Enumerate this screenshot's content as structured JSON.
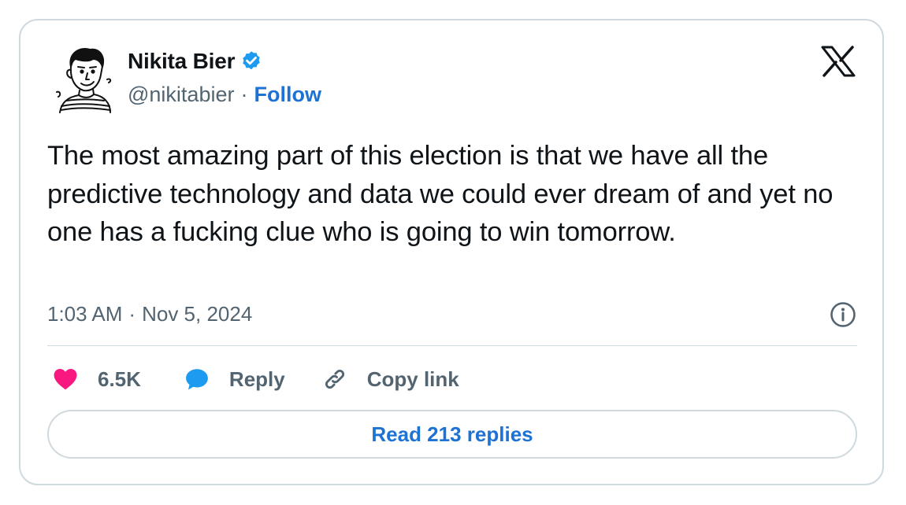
{
  "author": {
    "name": "Nikita Bier",
    "handle": "@nikitabier",
    "separator": "·",
    "follow_label": "Follow",
    "verified": true,
    "verified_color": "#1d9bf0"
  },
  "tweet": {
    "text": "The most amazing part of this election is that we have all the predictive technology and data we could ever dream of and yet no one has a fucking clue who is going to win tomorrow.",
    "time": "1:03 AM",
    "separator": "·",
    "date": "Nov 5, 2024"
  },
  "actions": {
    "like_count": "6.5K",
    "reply_label": "Reply",
    "copy_link_label": "Copy link"
  },
  "read_replies_label": "Read 213 replies",
  "colors": {
    "heart": "#f91880",
    "reply_bubble": "#1d9bf0",
    "link_blue": "#1d72d4",
    "text_primary": "#0f1419",
    "text_secondary": "#536471",
    "border": "#cfd9de"
  },
  "icons": {
    "avatar": "cartoon-portrait",
    "verified": "verified-badge-icon",
    "logo": "x-logo-icon",
    "info": "info-icon",
    "like": "heart-icon",
    "reply": "speech-bubble-icon",
    "copy_link": "link-icon"
  }
}
